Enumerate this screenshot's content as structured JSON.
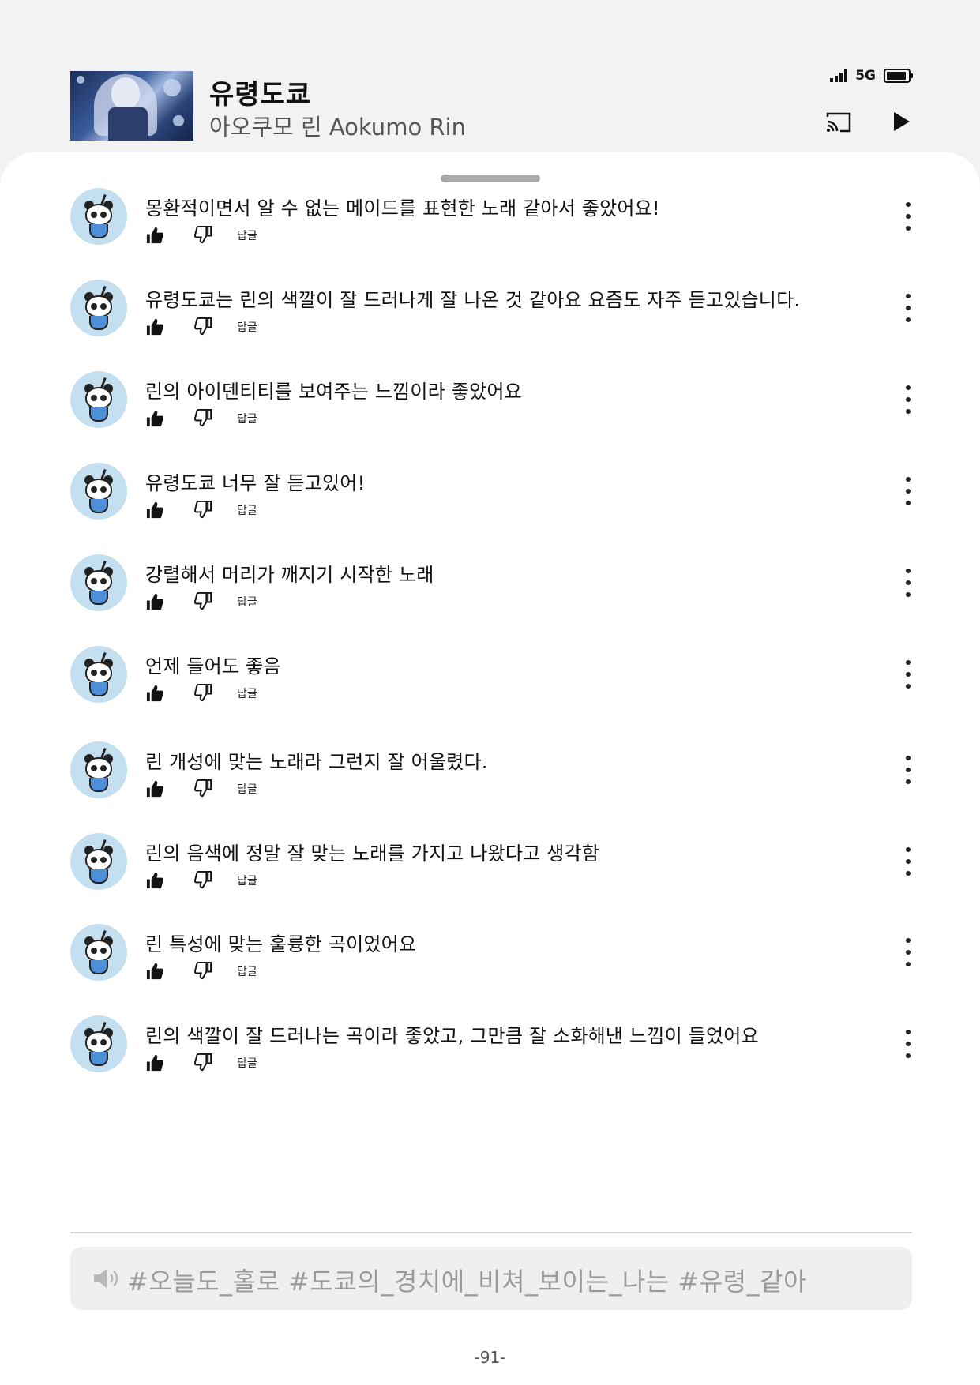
{
  "player": {
    "title": "유령도쿄",
    "artist": "아오쿠모 린 Aokumo Rin",
    "network": "5G",
    "thumbnail_icon": "album-art-thumbnail",
    "cast_icon": "cast-icon",
    "play_icon": "play-icon"
  },
  "comments": [
    {
      "text": "몽환적이면서 알 수 없는 메이드를 표현한 노래 같아서 좋았어요!",
      "reply_label": "답글"
    },
    {
      "text": "유령도쿄는 린의 색깔이 잘 드러나게 잘 나온 것 같아요 요즘도 자주 듣고있습니다.",
      "reply_label": "답글"
    },
    {
      "text": "린의 아이덴티티를 보여주는 느낌이라 좋았어요",
      "reply_label": "답글"
    },
    {
      "text": "유령도쿄 너무 잘 듣고있어!",
      "reply_label": "답글"
    },
    {
      "text": "강렬해서 머리가 깨지기 시작한 노래",
      "reply_label": "답글"
    },
    {
      "text": "언제 들어도 좋음",
      "reply_label": "답글"
    },
    {
      "text": "린 개성에 맞는 노래라 그런지 잘 어울렸다.",
      "reply_label": "답글"
    },
    {
      "text": "린의 음색에 정말 잘 맞는 노래를 가지고 나왔다고 생각함",
      "reply_label": "답글"
    },
    {
      "text": "린 특성에 맞는 훌륭한 곡이었어요",
      "reply_label": "답글"
    },
    {
      "text": "린의 색깔이 잘 드러나는 곡이라 좋았고, 그만큼 잘 소화해낸 느낌이 들었어요",
      "reply_label": "답글"
    }
  ],
  "lyric": {
    "text": "#오늘도_홀로 #도쿄의_경치에_비쳐_보이는_나는 #유령_같아",
    "icon": "speaker-icon"
  },
  "page_number": "-91-",
  "colors": {
    "background": "#f2f2f2",
    "sheet": "#ffffff",
    "avatar_bg": "#c4dff0",
    "lyric_bar": "#efefef",
    "lyric_text": "#9a9a9a"
  }
}
